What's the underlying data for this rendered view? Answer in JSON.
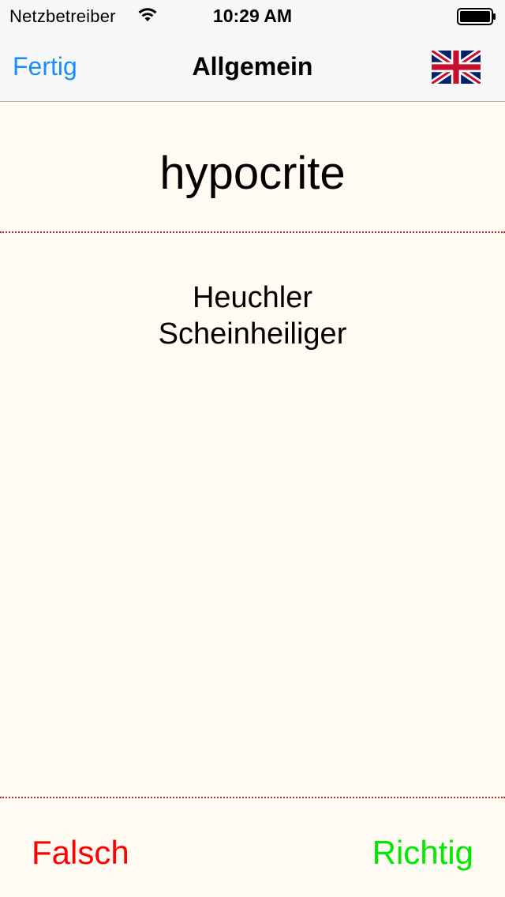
{
  "status_bar": {
    "carrier": "Netzbetreiber",
    "time": "10:29 AM",
    "wifi_icon": "wifi-icon",
    "battery_icon": "battery-icon"
  },
  "nav": {
    "done_label": "Fertig",
    "title": "Allgemein",
    "language_flag": "uk-flag-icon"
  },
  "card": {
    "term": "hypocrite",
    "translations": [
      "Heuchler",
      "Scheinheiliger"
    ]
  },
  "actions": {
    "wrong_label": "Falsch",
    "right_label": "Richtig"
  },
  "colors": {
    "accent": "#1a8cff",
    "wrong": "#ff0000",
    "right": "#00ea00",
    "divider": "#cc2a2a",
    "background": "#fffaf2"
  }
}
